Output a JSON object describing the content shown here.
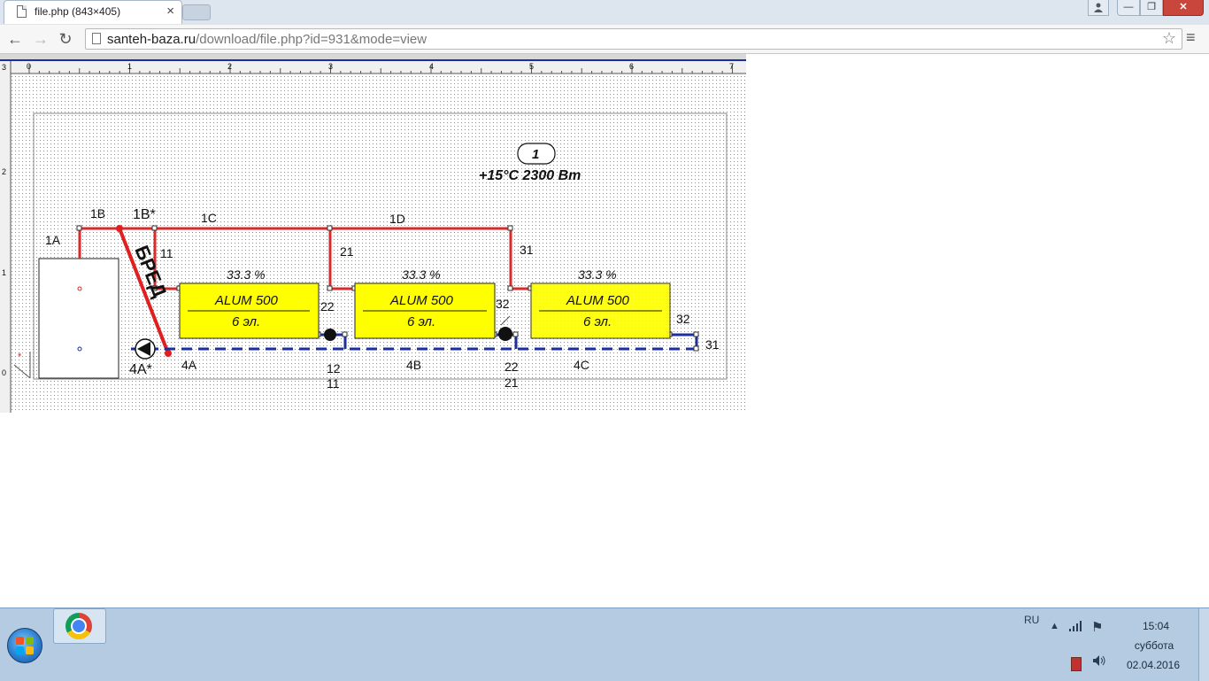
{
  "browser": {
    "tab_title": "file.php (843×405)",
    "tab_close": "×",
    "url_host": "santeh-baza.ru",
    "url_path": "/download/file.php?id=931&mode=view",
    "star": "☆",
    "menu": "≡",
    "back": "←",
    "forward": "→",
    "reload": "↻",
    "minimize": "—",
    "maximize": "❐",
    "close": "✕"
  },
  "drawing": {
    "ruler_labels": [
      "0",
      "1",
      "2",
      "3",
      "4",
      "5",
      "6",
      "7"
    ],
    "ruler_v_labels": [
      "3",
      "2",
      "1",
      "0"
    ],
    "room_number": "1",
    "room_info": "+15°C 2300 Вт",
    "nodes": {
      "n1A": "1A",
      "n1B": "1B",
      "n1Bs": "1B*",
      "n1C": "1C",
      "n1D": "1D",
      "n11": "11",
      "n21": "21",
      "n31": "31",
      "n22a": "22",
      "n32a": "32",
      "n32b": "32",
      "n31b": "31",
      "n4A": "4A",
      "n4As": "4A*",
      "n4B": "4B",
      "n4C": "4C",
      "n12": "12",
      "n11b": "11",
      "n22b": "22",
      "n21b": "21"
    },
    "radiators": [
      {
        "percent": "33.3 %",
        "model": "ALUM 500",
        "sections": "6 эл."
      },
      {
        "percent": "33.3 %",
        "model": "ALUM 500",
        "sections": "6 эл."
      },
      {
        "percent": "33.3 %",
        "model": "ALUM 500",
        "sections": "6 эл."
      }
    ],
    "annotation": "БРЕД",
    "colors": {
      "supply": "#d92b2b",
      "return": "#1b2f9e",
      "radiator": "#ffff00",
      "paper": "#ffffff",
      "dot": "#8a8a8a"
    }
  },
  "taskbar": {
    "language": "RU",
    "time": "15:04",
    "day": "суббота",
    "date": "02.04.2016",
    "tray_arrow": "▲",
    "tray_network": "▮",
    "tray_flag": "⚑",
    "tray_volume": "🔊"
  }
}
